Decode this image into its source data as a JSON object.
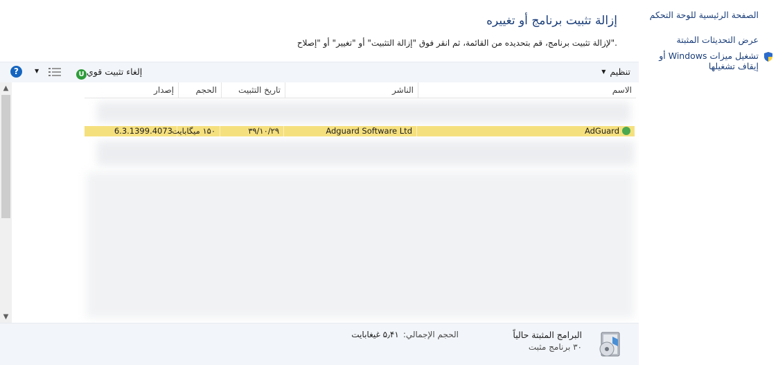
{
  "side": {
    "home": "الصفحة الرئيسية للوحة التحكم",
    "updates": "عرض التحديثات المثبتة",
    "features": "تشغيل ميزات Windows أو إيقاف تشغيلها"
  },
  "header": {
    "title": "إزالة تثبيت برنامج أو تغييره",
    "subtitle": "لإزالة تثبيت برنامج، قم بتحديده من القائمة، ثم انقر فوق \"إزالة التثبيت\" أو \"تغيير\" أو \"إصلاح\"."
  },
  "toolbar": {
    "organize": "تنظيم",
    "uninstall": "إلغاء تثبيت قوي",
    "uninstall_icon_letter": "U",
    "help": "?"
  },
  "columns": {
    "name": "الاسم",
    "publisher": "الناشر",
    "install_date": "تاريخ التثبيت",
    "size": "الحجم",
    "version": "إصدار"
  },
  "selected_row": {
    "name": "AdGuard",
    "publisher": "Adguard Software Ltd",
    "install_date": "۳۹/۱۰/۲۹",
    "size": "۱۵۰ میگابایت",
    "version": "6.3.1399.4073"
  },
  "status": {
    "title": "البرامج المثبتة حالياً",
    "total_label": "الحجم الإجمالي:",
    "total_value": "۵٫۴۱ غیغابایت",
    "count": "۳۰ برنامج مثبت"
  },
  "colors": {
    "link": "#1a3e7a",
    "selection": "#f5e07e",
    "toolbar_bg": "#f2f5f9"
  }
}
